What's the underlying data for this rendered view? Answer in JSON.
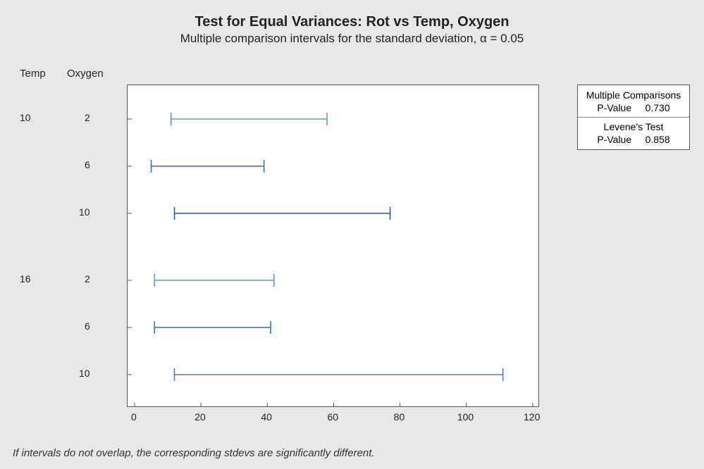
{
  "title": "Test for Equal Variances: Rot vs Temp, Oxygen",
  "subtitle": "Multiple comparison intervals for the standard deviation, α = 0.05",
  "factors": {
    "f1": "Temp",
    "f2": "Oxygen"
  },
  "xaxis": {
    "ticks": [
      0,
      20,
      40,
      60,
      80,
      100,
      120
    ],
    "min": 0,
    "max": 120
  },
  "temp_levels": [
    "10",
    "16"
  ],
  "oxygen_levels": [
    "2",
    "6",
    "10"
  ],
  "legend": {
    "mc_title": "Multiple Comparisons",
    "mc_label": "P-Value",
    "mc_value": "0.730",
    "lev_title": "Levene's Test",
    "lev_label": "P-Value",
    "lev_value": "0.858"
  },
  "footnote": "If intervals do not overlap, the corresponding stdevs are significantly different.",
  "chart_data": {
    "type": "interval",
    "title": "Test for Equal Variances: Rot vs Temp, Oxygen",
    "xlabel": "",
    "ylabel": "",
    "xlim": [
      0,
      120
    ],
    "series_meta": [
      {
        "temp": 10,
        "oxygen": 2
      },
      {
        "temp": 10,
        "oxygen": 6
      },
      {
        "temp": 10,
        "oxygen": 10
      },
      {
        "temp": 16,
        "oxygen": 2
      },
      {
        "temp": 16,
        "oxygen": 6
      },
      {
        "temp": 16,
        "oxygen": 10
      }
    ],
    "intervals": [
      {
        "lo": 11,
        "hi": 58
      },
      {
        "lo": 5,
        "hi": 39
      },
      {
        "lo": 12,
        "hi": 77
      },
      {
        "lo": 6,
        "hi": 42
      },
      {
        "lo": 6,
        "hi": 41
      },
      {
        "lo": 12,
        "hi": 111
      }
    ],
    "tests": {
      "multiple_comparisons_p": 0.73,
      "levene_p": 0.858
    }
  }
}
